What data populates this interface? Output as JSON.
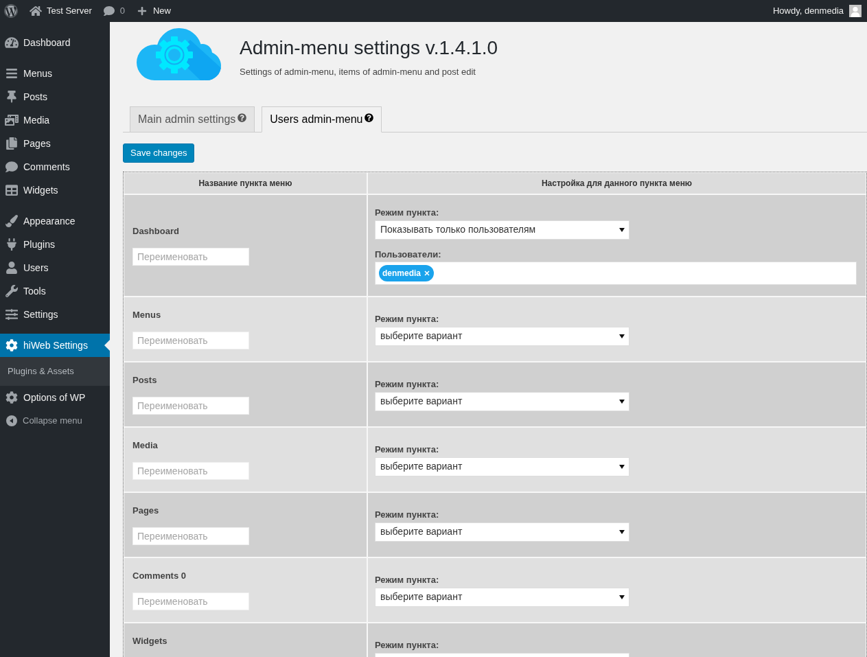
{
  "top_bar": {
    "site_name": "Test Server",
    "comments_count": "0",
    "new_label": "New",
    "greeting": "Howdy, denmedia"
  },
  "sidebar": {
    "groups": [
      {
        "items": [
          {
            "label": "Dashboard",
            "selected": false
          }
        ]
      },
      {
        "items": [
          {
            "label": "Menus",
            "selected": false
          },
          {
            "label": "Posts",
            "selected": false
          },
          {
            "label": "Media",
            "selected": false
          },
          {
            "label": "Pages",
            "selected": false
          },
          {
            "label": "Comments",
            "selected": false
          },
          {
            "label": "Widgets",
            "selected": false
          }
        ]
      },
      {
        "items": [
          {
            "label": "Appearance",
            "selected": false
          },
          {
            "label": "Plugins",
            "selected": false
          },
          {
            "label": "Users",
            "selected": false
          },
          {
            "label": "Tools",
            "selected": false
          },
          {
            "label": "Settings",
            "selected": false
          }
        ]
      },
      {
        "items": [
          {
            "label": "hiWeb Settings",
            "selected": true,
            "children": [
              {
                "label": "Plugins & Assets",
                "selected": false
              }
            ]
          },
          {
            "label": "Options of WP",
            "selected": false
          }
        ]
      }
    ],
    "collapse_label": "Collapse menu"
  },
  "header": {
    "title": "Admin-menu settings v.1.4.1.0",
    "subtitle": "Settings of admin-menu, items of admin-menu and post edit"
  },
  "tabs": [
    {
      "label": "Main admin settings",
      "selected": false
    },
    {
      "label": "Users admin-menu",
      "selected": true
    }
  ],
  "save_button": "Save changes",
  "table": {
    "columns": [
      "Название пункта меню",
      "Настройка для данного пункта меню"
    ],
    "rows": [
      {
        "name": "Dashboard",
        "rename_placeholder": "Переименовать",
        "mode_label": "Режим пункта:",
        "mode_value": "Показывать только пользователям",
        "users_label": "Пользователи:",
        "users": [
          "denmedia"
        ]
      },
      {
        "name": "Menus",
        "rename_placeholder": "Переименовать",
        "mode_label": "Режим пункта:",
        "mode_value": "выберите вариант"
      },
      {
        "name": "Posts",
        "rename_placeholder": "Переименовать",
        "mode_label": "Режим пункта:",
        "mode_value": "выберите вариант"
      },
      {
        "name": "Media",
        "rename_placeholder": "Переименовать",
        "mode_label": "Режим пункта:",
        "mode_value": "выберите вариант"
      },
      {
        "name": "Pages",
        "rename_placeholder": "Переименовать",
        "mode_label": "Режим пункта:",
        "mode_value": "выберите вариант"
      },
      {
        "name": "Comments 0",
        "rename_placeholder": "Переименовать",
        "mode_label": "Режим пункта:",
        "mode_value": "выберите вариант"
      },
      {
        "name": "Widgets",
        "mode_label": "Режим пункта:"
      }
    ]
  }
}
